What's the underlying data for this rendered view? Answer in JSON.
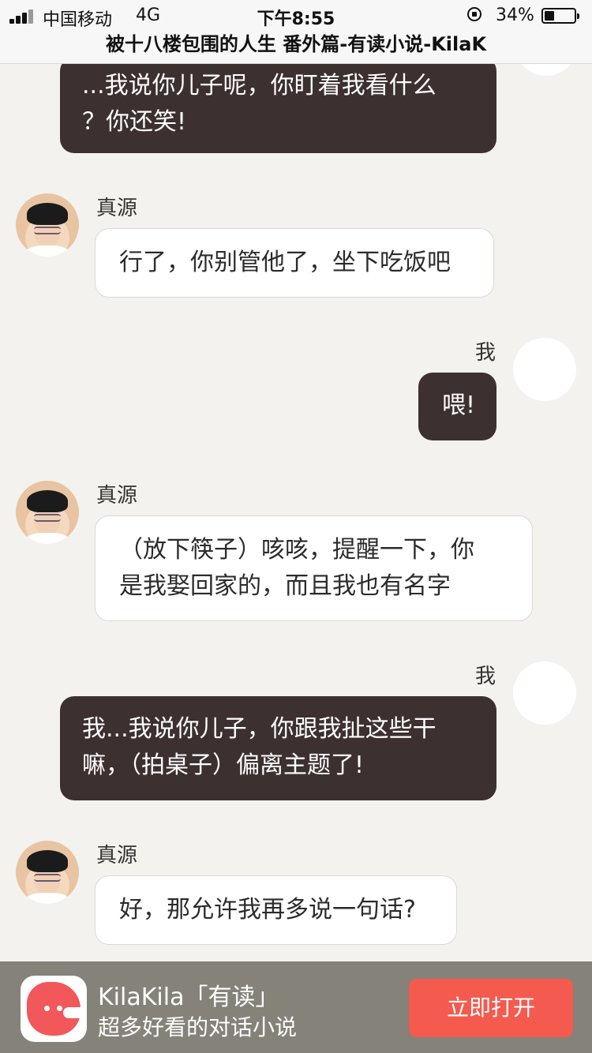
{
  "status_bar": {
    "carrier": "中国移动",
    "network": "4G",
    "time": "下午8:55",
    "battery_percent_text": "34%",
    "battery_level": 0.34
  },
  "page": {
    "title": "被十八楼包围的人生 番外篇-有读小说-KilaK"
  },
  "messages": [
    {
      "side": "right",
      "speaker": "",
      "lines": [
        "...我说你儿子呢，你盯着我看什么",
        "？你还笑!"
      ]
    },
    {
      "side": "left",
      "speaker": "真源",
      "lines": [
        "行了，你别管他了，坐下吃饭吧"
      ]
    },
    {
      "side": "right",
      "speaker": "我",
      "lines": [
        "喂!"
      ]
    },
    {
      "side": "left",
      "speaker": "真源",
      "lines": [
        "（放下筷子）咳咳，提醒一下，你",
        "是我娶回家的，而且我也有名字"
      ]
    },
    {
      "side": "right",
      "speaker": "我",
      "lines": [
        "我...我说你儿子，你跟我扯这些干",
        "嘛，（拍桌子）偏离主题了!"
      ]
    },
    {
      "side": "left",
      "speaker": "真源",
      "lines": [
        "好，那允许我再多说一句话?"
      ]
    }
  ],
  "banner": {
    "title": "KilaKila「有读」",
    "subtitle": "超多好看的对话小说",
    "button_label": "立即打开"
  },
  "colors": {
    "background": "#f4f2ee",
    "right_bubble": "#3d3030",
    "left_bubble": "#ffffff",
    "banner": "#858279",
    "accent_button": "#f45a4e"
  },
  "icons": {
    "signal": "signal-bars-icon",
    "orientation_lock": "orientation-lock-icon",
    "battery": "battery-icon",
    "app": "kilakila-app-icon"
  }
}
